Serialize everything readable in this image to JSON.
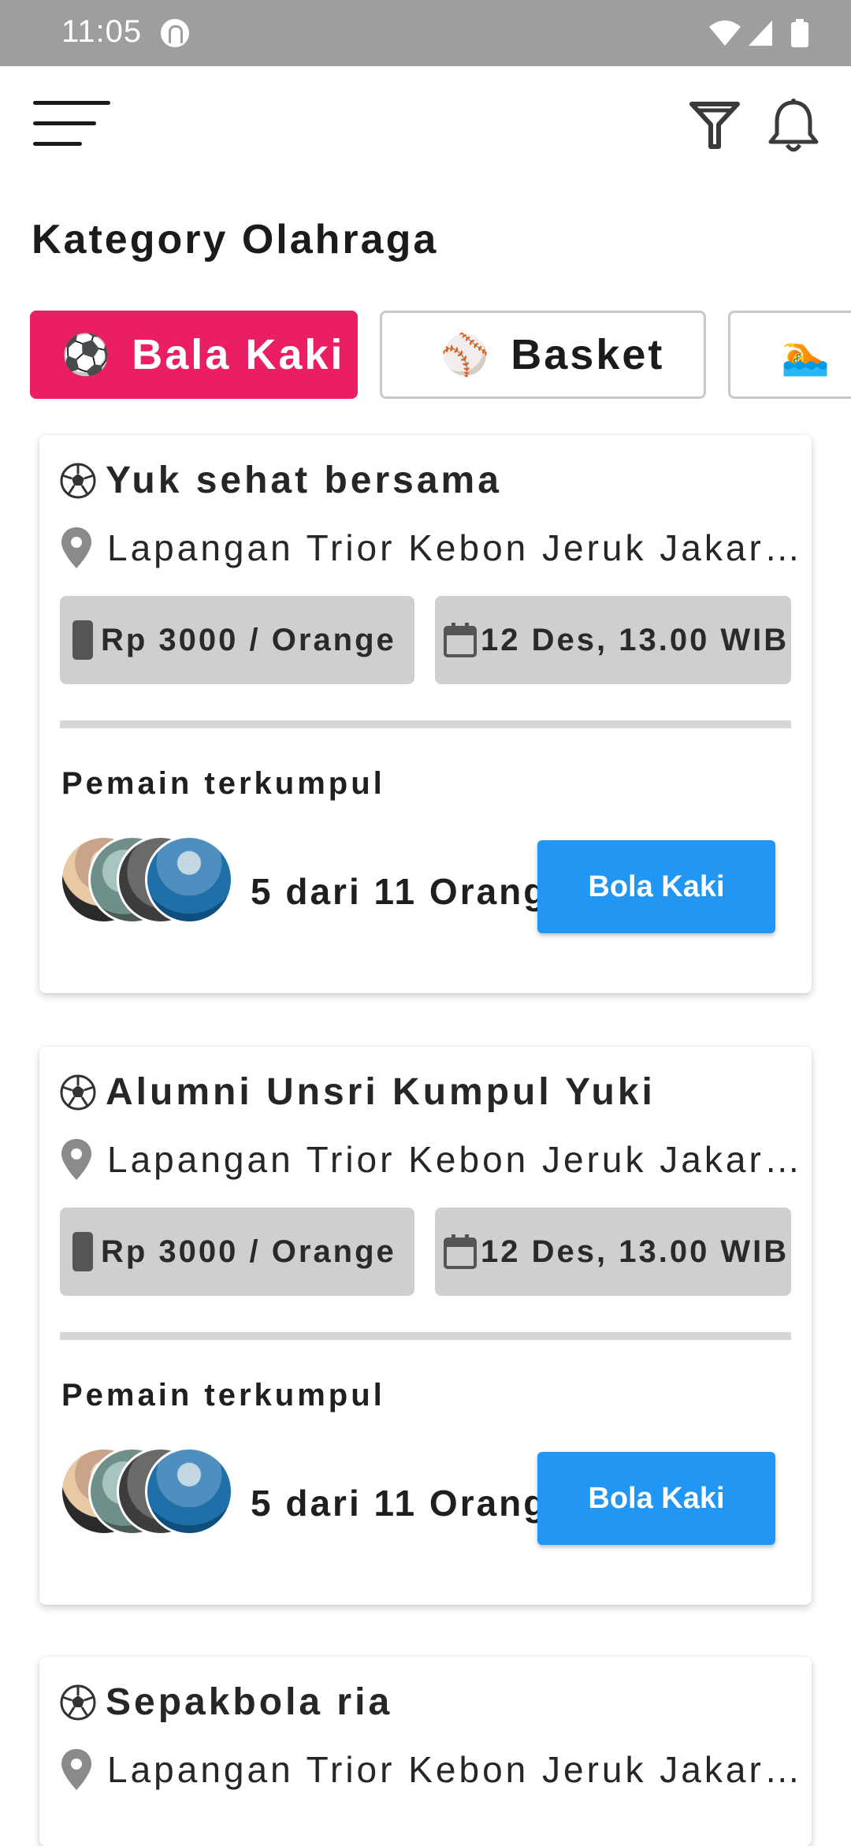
{
  "status_bar": {
    "time": "11:05"
  },
  "page": {
    "title": "Kategory Olahraga"
  },
  "categories": [
    {
      "label": "Bala Kaki",
      "emoji": "⚽",
      "active": true
    },
    {
      "label": "Basket",
      "emoji": "⚾",
      "active": false
    },
    {
      "label": "",
      "emoji": "🏊",
      "active": false
    }
  ],
  "events": [
    {
      "title": "Yuk sehat bersama",
      "location": "Lapangan Trior Kebon Jeruk Jakarta",
      "price": "Rp 3000 / Orange",
      "date": "12 Des, 13.00 WIB",
      "players_label": "Pemain terkumpul",
      "count": "5 dari 11 Orang",
      "button": "Bola Kaki"
    },
    {
      "title": "Alumni Unsri Kumpul Yuki",
      "location": "Lapangan Trior Kebon Jeruk Jakarta",
      "price": "Rp 3000 / Orange",
      "date": "12 Des, 13.00 WIB",
      "players_label": "Pemain terkumpul",
      "count": "5 dari 11 Orang",
      "button": "Bola Kaki"
    },
    {
      "title": "Sepakbola ria",
      "location": "Lapangan Trior Kebon Jeruk Jakarta"
    }
  ],
  "colors": {
    "accent": "#e91e63",
    "button": "#2196f3",
    "pill": "#cfcfcf"
  }
}
